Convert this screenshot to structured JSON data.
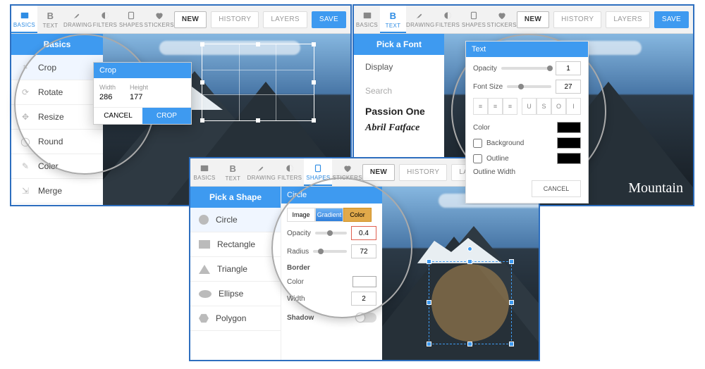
{
  "toolbar": {
    "basics": "BASICS",
    "text": "TEXT",
    "drawing": "DRAWING",
    "filters": "FILTERS",
    "shapes": "SHAPES",
    "stickers": "STICKERS",
    "new": "NEW",
    "history": "HISTORY",
    "layers": "LAYERS",
    "save": "SAVE"
  },
  "A": {
    "sideTitle": "Basics",
    "items": [
      "Crop",
      "Rotate",
      "Resize",
      "Round",
      "Color",
      "Merge"
    ],
    "crop": {
      "title": "Crop",
      "wLabel": "Width",
      "hLabel": "Height",
      "w": "286",
      "h": "177",
      "cancel": "CANCEL",
      "apply": "CROP"
    }
  },
  "B": {
    "sideTitle": "Pick a Font",
    "displayLabel": "Display",
    "searchLabel": "Search",
    "fonts": [
      "Passion One",
      "Abril Fatface"
    ],
    "panel": {
      "title": "Text",
      "opacity": "Opacity",
      "opVal": "1",
      "fontSize": "Font Size",
      "fsVal": "27",
      "color": "Color",
      "bg": "Background",
      "outline": "Outline",
      "outlineWidth": "Outline Width",
      "cancel": "CANCEL"
    },
    "overlayText": "Mountain"
  },
  "C": {
    "sideTitle": "Pick a Shape",
    "shapes": [
      "Circle",
      "Rectangle",
      "Triangle",
      "Ellipse",
      "Polygon"
    ],
    "panel": {
      "title": "Circle",
      "tabs": [
        "Image",
        "Gradient",
        "Color"
      ],
      "opacity": "Opacity",
      "opVal": "0.4",
      "radius": "Radius",
      "radVal": "72",
      "border": "Border",
      "color": "Color",
      "width": "Width",
      "widthVal": "2",
      "shadow": "Shadow"
    }
  }
}
